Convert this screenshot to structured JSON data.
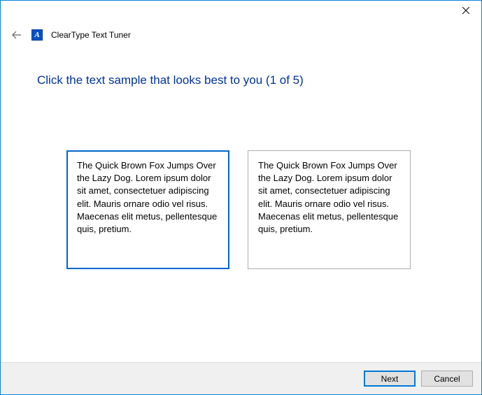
{
  "app_title": "ClearType Text Tuner",
  "instruction": "Click the text sample that looks best to you (1 of 5)",
  "sample_text": "The Quick Brown Fox Jumps Over the Lazy Dog. Lorem ipsum dolor sit amet, consectetuer adipiscing elit. Mauris ornare odio vel risus. Maecenas elit metus, pellentesque quis, pretium.",
  "buttons": {
    "next": "Next",
    "cancel": "Cancel"
  },
  "app_icon_letter": "A"
}
